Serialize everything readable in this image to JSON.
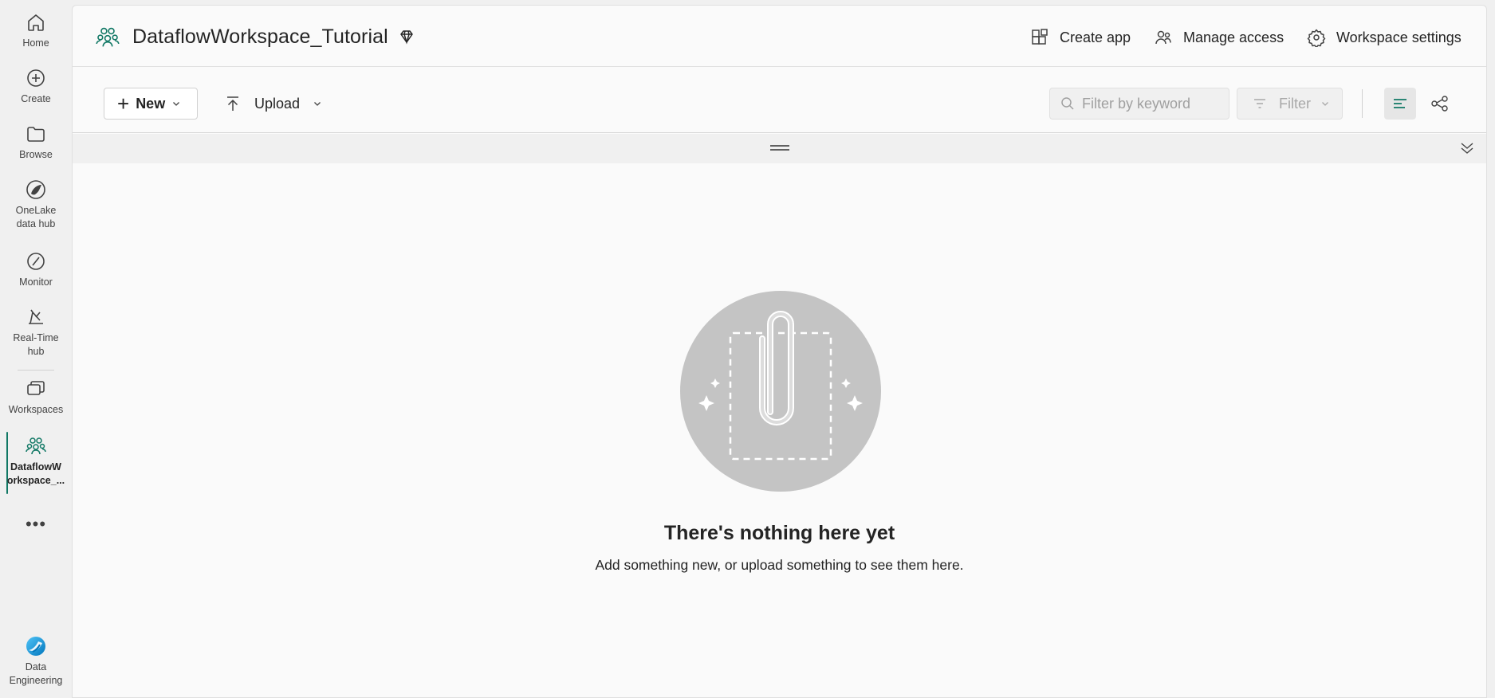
{
  "rail": {
    "home": "Home",
    "create": "Create",
    "browse": "Browse",
    "onelake_line1": "OneLake",
    "onelake_line2": "data hub",
    "monitor": "Monitor",
    "realtime_line1": "Real-Time",
    "realtime_line2": "hub",
    "workspaces": "Workspaces",
    "current_ws_line1": "DataflowW",
    "current_ws_line2": "orkspace_...",
    "more": "•••",
    "experience_line1": "Data",
    "experience_line2": "Engineering"
  },
  "header": {
    "title": "DataflowWorkspace_Tutorial",
    "create_app": "Create app",
    "manage_access": "Manage access",
    "workspace_settings": "Workspace settings"
  },
  "toolbar": {
    "new_label": "New",
    "upload_label": "Upload",
    "search_placeholder": "Filter by keyword",
    "filter_label": "Filter"
  },
  "empty_state": {
    "title": "There's nothing here yet",
    "subtitle": "Add something new, or upload something to see them here."
  },
  "colors": {
    "accent": "#117865",
    "illustration_bg": "#c4c4c4"
  }
}
